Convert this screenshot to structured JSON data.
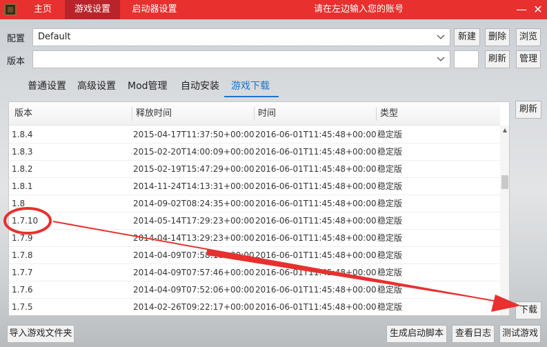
{
  "titlebar": {
    "tabs": [
      {
        "label": "主页",
        "active": false
      },
      {
        "label": "游戏设置",
        "active": true
      },
      {
        "label": "启动器设置",
        "active": false
      }
    ],
    "title": "请在左边输入您的账号",
    "minimize": "—",
    "close": "✕"
  },
  "config": {
    "label": "配置",
    "value": "Default",
    "buttons": {
      "new": "新建",
      "delete": "删除",
      "browse": "浏览"
    }
  },
  "version": {
    "label": "版本",
    "value": "",
    "buttons": {
      "refresh": "刷新",
      "manage": "管理"
    }
  },
  "subtabs": [
    {
      "label": "普通设置",
      "active": false
    },
    {
      "label": "高级设置",
      "active": false
    },
    {
      "label": "Mod管理",
      "active": false
    },
    {
      "label": "自动安装",
      "active": false
    },
    {
      "label": "游戏下载",
      "active": true
    }
  ],
  "table": {
    "columns": [
      "版本",
      "释放时间",
      "时间",
      "类型"
    ],
    "rows": [
      {
        "version": "1.8.4",
        "release": "2015-04-17T11:37:50+00:00",
        "time": "2016-06-01T11:45:48+00:00",
        "type": "稳定版"
      },
      {
        "version": "1.8.3",
        "release": "2015-02-20T14:00:09+00:00",
        "time": "2016-06-01T11:45:48+00:00",
        "type": "稳定版"
      },
      {
        "version": "1.8.2",
        "release": "2015-02-19T15:47:29+00:00",
        "time": "2016-06-01T11:45:48+00:00",
        "type": "稳定版"
      },
      {
        "version": "1.8.1",
        "release": "2014-11-24T14:13:31+00:00",
        "time": "2016-06-01T11:45:48+00:00",
        "type": "稳定版"
      },
      {
        "version": "1.8",
        "release": "2014-09-02T08:24:35+00:00",
        "time": "2016-06-01T11:45:48+00:00",
        "type": "稳定版"
      },
      {
        "version": "1.7.10",
        "release": "2014-05-14T17:29:23+00:00",
        "time": "2016-06-01T11:45:48+00:00",
        "type": "稳定版"
      },
      {
        "version": "1.7.9",
        "release": "2014-04-14T13:29:23+00:00",
        "time": "2016-06-01T11:45:48+00:00",
        "type": "稳定版"
      },
      {
        "version": "1.7.8",
        "release": "2014-04-09T07:58:16+00:00",
        "time": "2016-06-01T11:45:48+00:00",
        "type": "稳定版"
      },
      {
        "version": "1.7.7",
        "release": "2014-04-09T07:57:46+00:00",
        "time": "2016-06-01T11:45:48+00:00",
        "type": "稳定版"
      },
      {
        "version": "1.7.6",
        "release": "2014-04-09T07:52:06+00:00",
        "time": "2016-06-01T11:45:48+00:00",
        "type": "稳定版"
      },
      {
        "version": "1.7.5",
        "release": "2014-02-26T09:22:17+00:00",
        "time": "2016-06-01T11:45:48+00:00",
        "type": "稳定版"
      }
    ]
  },
  "side_buttons": {
    "refresh": "刷新",
    "download": "下载"
  },
  "bottom": {
    "import_folder": "导入游戏文件夹",
    "gen_script": "生成启动脚本",
    "view_log": "查看日志",
    "test_game": "测试游戏"
  },
  "colors": {
    "titlebar": "#e8302e",
    "titlebar_active_tab": "#b9242a",
    "accent": "#1c73c9",
    "annotation": "#e8302e"
  }
}
